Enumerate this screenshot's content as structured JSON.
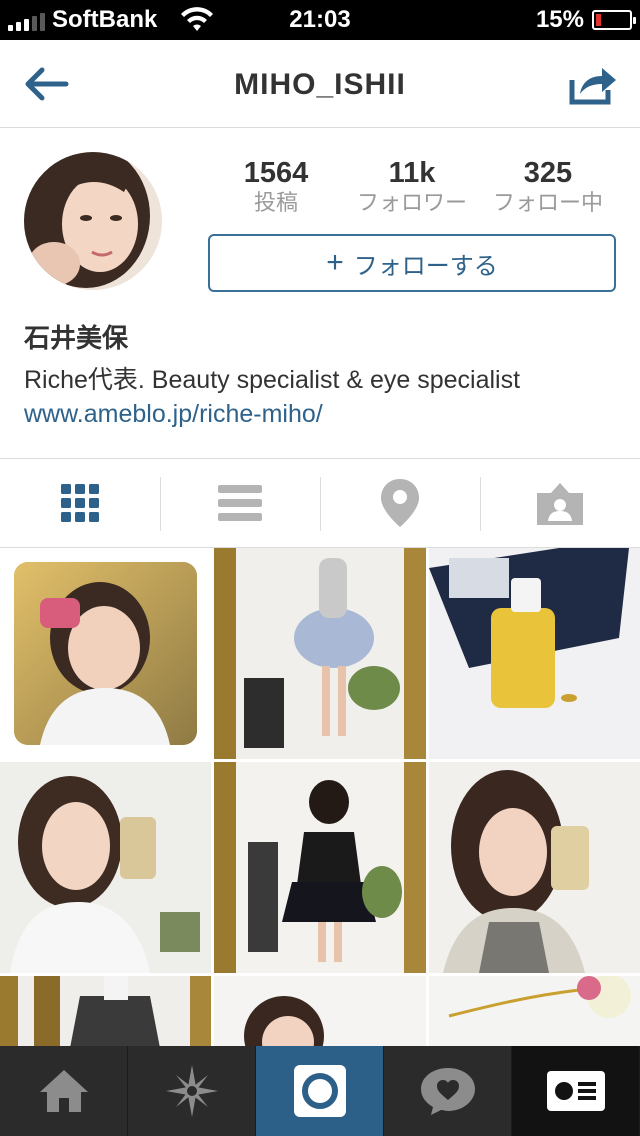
{
  "status_bar": {
    "carrier": "SoftBank",
    "time": "21:03",
    "battery_percent": "15%",
    "battery_level": 0.15,
    "icons": [
      "signal-icon",
      "wifi-icon",
      "battery-icon"
    ]
  },
  "nav": {
    "title": "MIHO_ISHII",
    "back_icon": "back-arrow-icon",
    "share_icon": "share-icon"
  },
  "profile": {
    "stats": [
      {
        "value": "1564",
        "label": "投稿"
      },
      {
        "value": "11k",
        "label": "フォロワー"
      },
      {
        "value": "325",
        "label": "フォロー中"
      }
    ],
    "follow_button": "フォローする",
    "follow_plus": "+",
    "name": "石井美保",
    "bio": "Riche代表. Beauty specialist & eye specialist",
    "website": "www.ameblo.jp/riche-miho/"
  },
  "view_tabs": {
    "items": [
      "grid-icon",
      "list-icon",
      "location-pin-icon",
      "tagged-photos-icon"
    ],
    "active_index": 0
  },
  "bottom_tabs": {
    "items": [
      "home-icon",
      "explore-icon",
      "camera-icon",
      "activity-icon",
      "profile-icon"
    ],
    "active_index": 2
  },
  "colors": {
    "accent": "#2f628a",
    "tab_active": "#2d6089",
    "tabbar_bg": "#2b2b2b",
    "muted_text": "#9a9a9a"
  }
}
